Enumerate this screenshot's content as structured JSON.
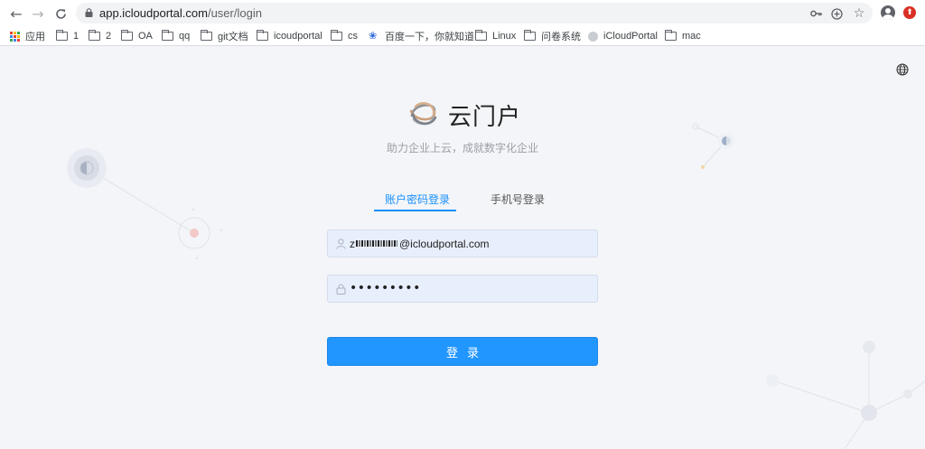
{
  "browser": {
    "url_host": "app.icloudportal.com",
    "url_path": "/user/login",
    "bookmarks": [
      {
        "label": "应用",
        "icon": "apps-grid-icon"
      },
      {
        "label": "1",
        "icon": "folder-icon"
      },
      {
        "label": "2",
        "icon": "folder-icon"
      },
      {
        "label": "OA",
        "icon": "folder-icon"
      },
      {
        "label": "qq",
        "icon": "folder-icon"
      },
      {
        "label": "git文档",
        "icon": "folder-icon"
      },
      {
        "label": "icoudportal",
        "icon": "folder-icon"
      },
      {
        "label": "cs",
        "icon": "folder-icon"
      },
      {
        "label": "百度一下，你就知道",
        "icon": "baidu-paw-icon"
      },
      {
        "label": "Linux",
        "icon": "folder-icon"
      },
      {
        "label": "问卷系统",
        "icon": "folder-icon"
      },
      {
        "label": "iCloudPortal",
        "icon": "site-favicon"
      },
      {
        "label": "mac",
        "icon": "folder-icon"
      }
    ]
  },
  "login": {
    "brand_name": "云门户",
    "slogan": "助力企业上云，成就数字化企业",
    "tab_account": "账户密码登录",
    "tab_phone": "手机号登录",
    "username_prefix": "z",
    "username_suffix": "@icloudportal.com",
    "password_mask": "•••••••••",
    "submit_label": "登录"
  },
  "colors": {
    "accent": "#1890ff",
    "button": "#2196ff",
    "input_bg": "#e8effc",
    "page_bg": "#f4f5f8"
  }
}
